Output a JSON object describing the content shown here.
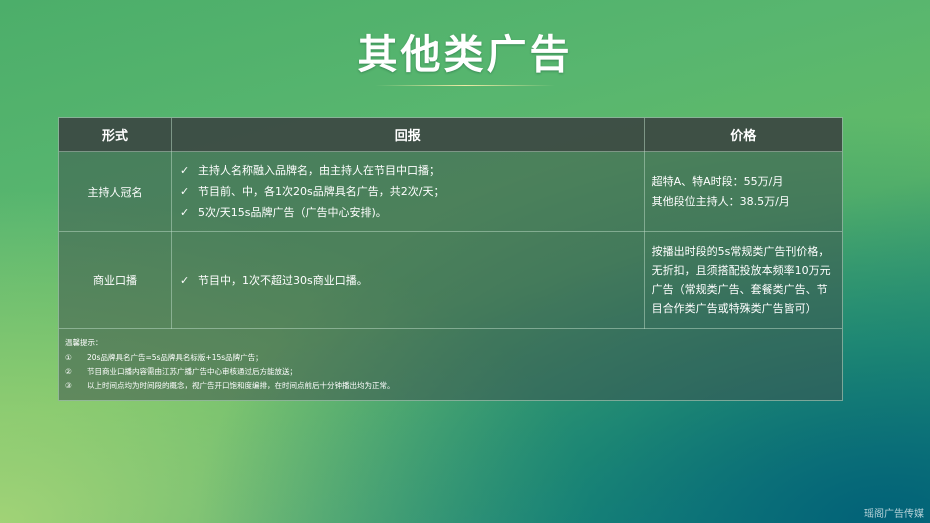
{
  "title": "其他类广告",
  "table": {
    "headers": [
      "形式",
      "回报",
      "价格"
    ],
    "rows": [
      {
        "form": "主持人冠名",
        "returns": [
          "主持人名称融入品牌名，由主持人在节目中口播；",
          "节目前、中，各1次20s品牌具名广告，共2次/天；",
          "5次/天15s品牌广告（广告中心安排)。"
        ],
        "price": [
          "超特A、特A时段：55万/月",
          "其他段位主持人：38.5万/月"
        ]
      },
      {
        "form": "商业口播",
        "returns": [
          "节目中，1次不超过30s商业口播。"
        ],
        "price": [
          "按播出时段的5s常规类广告刊价格，无折扣，且须搭配投放本频率10万元广告（常规类广告、套餐类广告、节目合作类广告或特殊类广告皆可）"
        ]
      }
    ]
  },
  "notes": {
    "heading": "温馨提示：",
    "items": [
      {
        "num": "①",
        "text": "20s品牌具名广告=5s品牌具名标版+15s品牌广告；"
      },
      {
        "num": "②",
        "text": "节目商业口播内容需由江苏广播广告中心审核通过后方能放送；"
      },
      {
        "num": "③",
        "text": "以上时间点均为时间段的概念，视广告开口饱和度编排，在时间点前后十分钟播出均为正常。"
      }
    ]
  },
  "watermark": "瑶阁广告传媒",
  "icons": {
    "check": "checkmark-icon"
  },
  "colors": {
    "text": "#ffffff",
    "table_bg": "#3e544e"
  }
}
